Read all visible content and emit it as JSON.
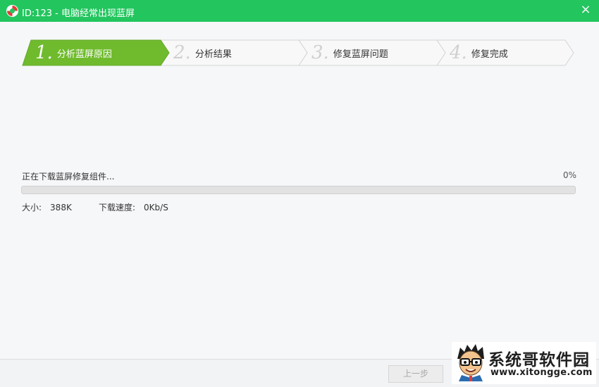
{
  "window": {
    "title": "ID:123 - 电脑经常出现蓝屏",
    "accent_color": "#22c55e",
    "close_icon": "×"
  },
  "steps": [
    {
      "number": "1.",
      "label": "分析蓝屏原因",
      "active": true
    },
    {
      "number": "2.",
      "label": "分析结果",
      "active": false
    },
    {
      "number": "3.",
      "label": "修复蓝屏问题",
      "active": false
    },
    {
      "number": "4.",
      "label": "修复完成",
      "active": false
    }
  ],
  "step_colors": {
    "active": "#6fbb2d",
    "inactive": "#f8f8f8"
  },
  "download": {
    "status": "正在下载蓝屏修复组件...",
    "percent_text": "0%",
    "progress": 0,
    "size_label": "大小:",
    "size_value": "388K",
    "speed_label": "下载速度:",
    "speed_value": "0Kb/S"
  },
  "footer": {
    "prev_button": "上一步"
  },
  "watermark": {
    "brand": "系统哥软件园",
    "site": "www.xitongge.com"
  }
}
